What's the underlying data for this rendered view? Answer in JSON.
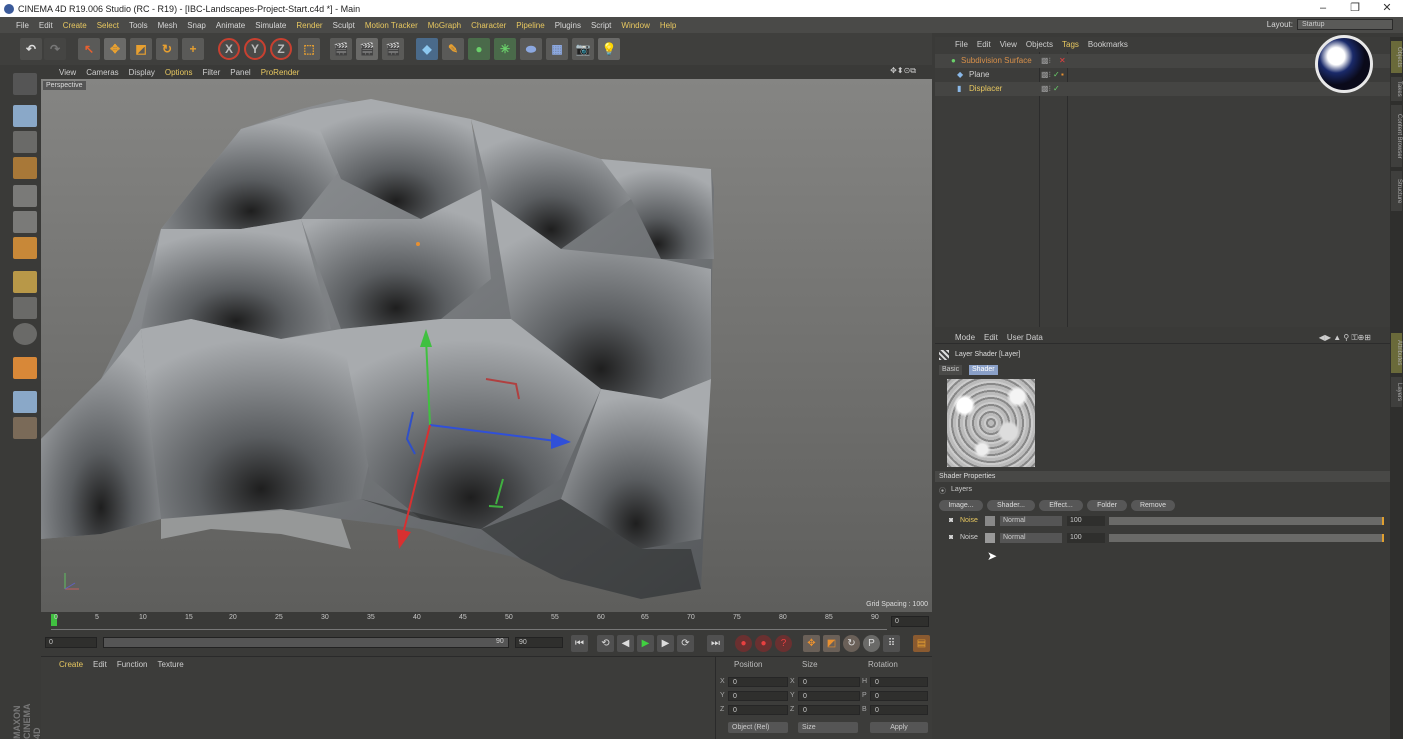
{
  "window": {
    "title": "CINEMA 4D R19.006 Studio (RC - R19) - [IBC-Landscapes-Project-Start.c4d *] - Main",
    "minimize": "–",
    "restore": "❐",
    "close": "✕"
  },
  "menubar": {
    "items": [
      "File",
      "Edit",
      "Create",
      "Select",
      "Tools",
      "Mesh",
      "Snap",
      "Animate",
      "Simulate",
      "Render",
      "Sculpt",
      "Motion Tracker",
      "MoGraph",
      "Character",
      "Pipeline",
      "Plugins",
      "Script",
      "Window",
      "Help"
    ],
    "layout_label": "Layout:",
    "layout_value": "Startup"
  },
  "toolbar": {
    "axis_x": "X",
    "axis_y": "Y",
    "axis_z": "Z"
  },
  "viewport": {
    "menu": [
      "View",
      "Cameras",
      "Display",
      "Options",
      "Filter",
      "Panel",
      "ProRender"
    ],
    "camera_label": "Perspective",
    "grid_spacing": "Grid Spacing : 1000"
  },
  "timeline": {
    "ticks": [
      "0",
      "5",
      "10",
      "15",
      "20",
      "25",
      "30",
      "35",
      "40",
      "45",
      "50",
      "55",
      "60",
      "65",
      "70",
      "75",
      "80",
      "85",
      "90"
    ],
    "frame_field": "0",
    "start_field": "0",
    "end_field": "90",
    "end_field2": "90"
  },
  "material_manager": {
    "menu": [
      "Create",
      "Edit",
      "Function",
      "Texture"
    ]
  },
  "coordinates": {
    "headers": [
      "Position",
      "Size",
      "Rotation"
    ],
    "pos_labels": [
      "X",
      "Y",
      "Z"
    ],
    "size_labels": [
      "X",
      "Y",
      "Z"
    ],
    "rot_labels": [
      "H",
      "P",
      "B"
    ],
    "values": [
      "0",
      "0",
      "0"
    ],
    "mode_dropdown": "Object (Rel)",
    "size_dropdown": "Size",
    "apply": "Apply"
  },
  "object_manager": {
    "menu": [
      "File",
      "Edit",
      "View",
      "Objects",
      "Tags",
      "Bookmarks"
    ],
    "objects": [
      {
        "name": "Subdivision Surface",
        "color": "#d8904a"
      },
      {
        "name": "Plane",
        "color": "#cfcfcf"
      },
      {
        "name": "Displacer",
        "color": "#e8c860"
      }
    ]
  },
  "attribute_manager": {
    "menu": [
      "Mode",
      "Edit",
      "User Data"
    ],
    "title": "Layer Shader [Layer]",
    "tabs": [
      "Basic",
      "Shader"
    ],
    "section": "Shader Properties",
    "layers_label": "Layers",
    "buttons": [
      "Image...",
      "Shader...",
      "Effect...",
      "Folder",
      "Remove"
    ],
    "layers": [
      {
        "name": "Noise",
        "blend": "Normal",
        "opacity": "100",
        "active": true
      },
      {
        "name": "Noise",
        "blend": "Normal",
        "opacity": "100",
        "active": false
      }
    ]
  },
  "right_tabs": [
    "Objects",
    "Takes",
    "Content Browser",
    "Structure",
    "Attributes",
    "Layers"
  ],
  "branding": "MAXON CINEMA 4D",
  "colors": {
    "accent": "#e8c860",
    "selection": "#d8904a",
    "x_axis": "#d83030",
    "y_axis": "#40c040",
    "z_axis": "#3050d8"
  }
}
